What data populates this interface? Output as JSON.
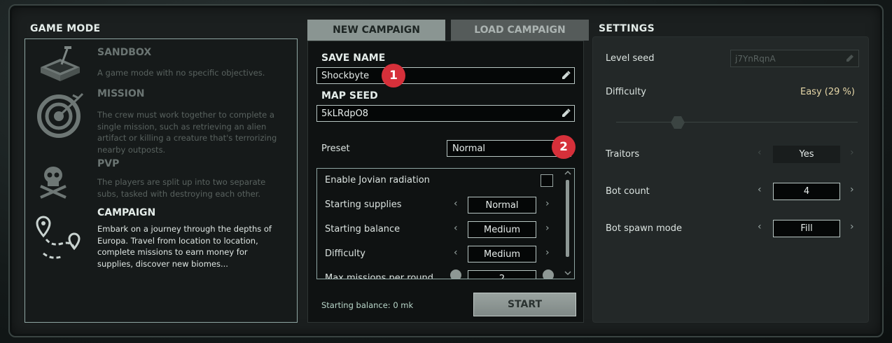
{
  "game_mode": {
    "title": "GAME MODE",
    "modes": [
      {
        "title": "SANDBOX",
        "desc": "A game mode with no specific objectives.",
        "icon": "sandbox-icon"
      },
      {
        "title": "MISSION",
        "desc": "The crew must work together to complete a single mission, such as retrieving an alien artifact or killing a creature that's terrorizing nearby outposts.",
        "icon": "target-icon"
      },
      {
        "title": "PVP",
        "desc": "The players are split up into two separate subs, tasked with destroying each other.",
        "icon": "skull-icon"
      },
      {
        "title": "CAMPAIGN",
        "desc": "Embark on a journey through the depths of Europa. Travel from location to location, complete missions to earn money for supplies, discover new biomes...",
        "icon": "route-icon"
      }
    ]
  },
  "tabs": {
    "new": "NEW CAMPAIGN",
    "load": "LOAD CAMPAIGN"
  },
  "campaign": {
    "save_name_label": "SAVE NAME",
    "save_name_value": "Shockbyte",
    "map_seed_label": "MAP SEED",
    "map_seed_value": "5kLRdpO8",
    "preset_label": "Preset",
    "preset_value": "Normal",
    "settings": {
      "jovian": "Enable Jovian radiation",
      "supplies_label": "Starting supplies",
      "supplies_value": "Normal",
      "balance_label": "Starting balance",
      "balance_value": "Medium",
      "difficulty_label": "Difficulty",
      "difficulty_value": "Medium",
      "missions_label": "Max missions per round",
      "missions_value": "2"
    },
    "footer": "Starting balance: 0 mk",
    "start": "START"
  },
  "badges": {
    "one": "1",
    "two": "2"
  },
  "settings": {
    "title": "SETTINGS",
    "level_seed_label": "Level seed",
    "level_seed_value": "j7YnRqnA",
    "difficulty_label": "Difficulty",
    "difficulty_value": "Easy (29 %)",
    "traitors_label": "Traitors",
    "traitors_value": "Yes",
    "bot_count_label": "Bot count",
    "bot_count_value": "4",
    "bot_spawn_label": "Bot spawn mode",
    "bot_spawn_value": "Fill"
  },
  "arrows": {
    "left": "‹",
    "right": "›"
  },
  "colors": {
    "accent_red": "#d6303a",
    "difficulty_text": "#e6d7a8"
  }
}
